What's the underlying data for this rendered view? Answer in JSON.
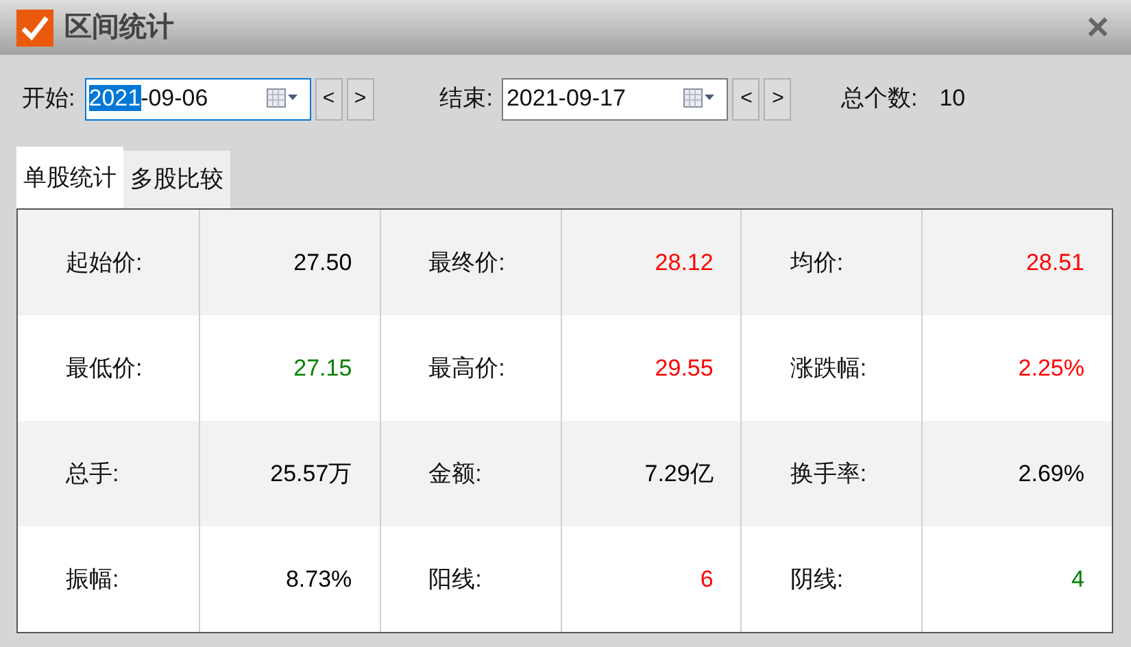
{
  "window": {
    "title": "区间统计",
    "close": "×"
  },
  "start": {
    "label": "开始:",
    "value_parts": [
      {
        "text": "2021",
        "selected": true
      },
      {
        "text": "-09-06",
        "selected": false
      }
    ],
    "prev": "<",
    "next": ">"
  },
  "end": {
    "label": "结束:",
    "value_parts": [
      {
        "text": "2021-09-17",
        "selected": false
      }
    ],
    "prev": "<",
    "next": ">"
  },
  "total": {
    "label": "总个数:",
    "value": "10"
  },
  "tabs": [
    {
      "label": "单股统计",
      "selected": true
    },
    {
      "label": "多股比较",
      "selected": false
    }
  ],
  "table": {
    "rows": [
      [
        {
          "label": "起始价:",
          "value": "27.50",
          "color": "#000000"
        },
        {
          "label": "最终价:",
          "value": "28.12",
          "color": "#ff0000"
        },
        {
          "label": "均价:",
          "value": "28.51",
          "color": "#ff0000"
        }
      ],
      [
        {
          "label": "最低价:",
          "value": "27.15",
          "color": "#008000"
        },
        {
          "label": "最高价:",
          "value": "29.55",
          "color": "#ff0000"
        },
        {
          "label": "涨跌幅:",
          "value": "2.25%",
          "color": "#ff0000"
        }
      ],
      [
        {
          "label": "总手:",
          "value": "25.57万",
          "color": "#000000"
        },
        {
          "label": "金额:",
          "value": "7.29亿",
          "color": "#000000"
        },
        {
          "label": "换手率:",
          "value": "2.69%",
          "color": "#000000"
        }
      ],
      [
        {
          "label": "振幅:",
          "value": "8.73%",
          "color": "#000000"
        },
        {
          "label": "阳线:",
          "value": "6",
          "color": "#ff0000"
        },
        {
          "label": "阴线:",
          "value": "4",
          "color": "#008000"
        }
      ]
    ]
  }
}
